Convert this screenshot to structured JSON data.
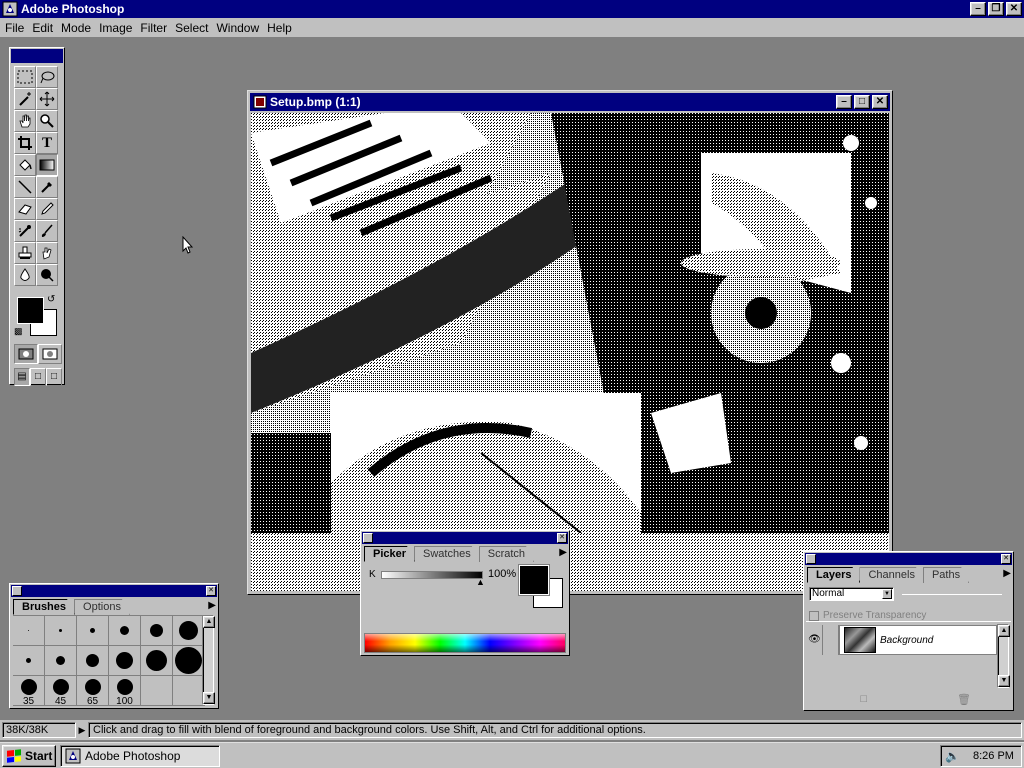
{
  "app": {
    "title": "Adobe Photoshop"
  },
  "menu": {
    "items": [
      {
        "label": "File"
      },
      {
        "label": "Edit"
      },
      {
        "label": "Mode"
      },
      {
        "label": "Image"
      },
      {
        "label": "Filter"
      },
      {
        "label": "Select"
      },
      {
        "label": "Window"
      },
      {
        "label": "Help"
      }
    ]
  },
  "document": {
    "title": "Setup.bmp  (1:1)"
  },
  "toolbox": {
    "tools": [
      "marquee-icon",
      "lasso-icon",
      "magic-wand-icon",
      "move-icon",
      "hand-icon",
      "zoom-icon",
      "crop-icon",
      "type-icon",
      "paint-bucket-icon",
      "gradient-icon",
      "line-icon",
      "eyedropper-icon",
      "eraser-icon",
      "pencil-icon",
      "airbrush-icon",
      "paintbrush-icon",
      "rubber-stamp-icon",
      "smudge-icon",
      "blur-icon",
      "dodge-burn-icon"
    ],
    "active_tool": "gradient-icon",
    "foreground_color": "#000000",
    "background_color": "#ffffff"
  },
  "picker": {
    "tabs": [
      {
        "label": "Picker"
      },
      {
        "label": "Swatches"
      },
      {
        "label": "Scratch"
      }
    ],
    "channel_label": "K",
    "value": "100%"
  },
  "brushes": {
    "tabs": [
      {
        "label": "Brushes"
      },
      {
        "label": "Options"
      }
    ],
    "labels": [
      "35",
      "45",
      "65",
      "100"
    ]
  },
  "layers": {
    "tabs": [
      {
        "label": "Layers"
      },
      {
        "label": "Channels"
      },
      {
        "label": "Paths"
      }
    ],
    "mode": "Normal",
    "preserve_label": "Preserve Transparency",
    "layer_name": "Background"
  },
  "status": {
    "size": "38K/38K",
    "message": "Click and drag to fill with blend of foreground and background colors.  Use Shift, Alt, and Ctrl for additional options."
  },
  "taskbar": {
    "start_label": "Start",
    "task_label": "Adobe Photoshop",
    "clock": "8:26 PM"
  }
}
